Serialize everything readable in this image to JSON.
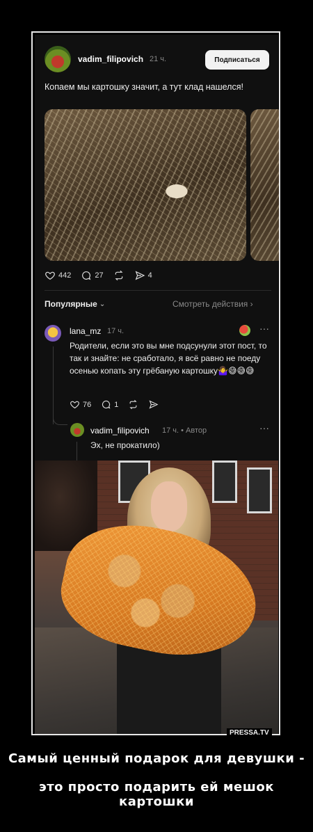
{
  "post": {
    "username": "vadim_filipovich",
    "time": "21 ч.",
    "subscribe_label": "Подписаться",
    "caption": "Копаем мы картошку значит, а тут клад нашелся!",
    "likes": "442",
    "comments": "27",
    "shares": "4"
  },
  "comments_section": {
    "sort_label": "Популярные",
    "see_actions": "Смотреть действия",
    "comment": {
      "username": "lana_mz",
      "time": "17 ч.",
      "text": "Родители, если это вы мне подсунули этот пост, то так и знайте: не сработало, я всё равно не поеду осенью копать эту грёбаную картошку🤷‍♀️😅😅😅",
      "likes": "76",
      "replies": "1"
    },
    "reply": {
      "username": "vadim_filipovich",
      "time": "17 ч. • Автор",
      "text": "Эх, не прокатило)"
    }
  },
  "watermark": "PRESSA.TV",
  "demotivator": {
    "line1": "Самый ценный подарок для девушки -",
    "line2": "это просто подарить ей мешок картошки"
  },
  "colors": {
    "background": "#000000",
    "post_background": "#101010",
    "muted_text": "#888888"
  }
}
